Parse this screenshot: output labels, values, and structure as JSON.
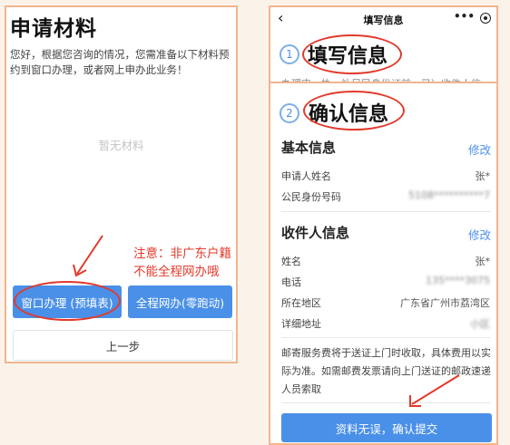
{
  "left": {
    "title": "申请材料",
    "description": "您好，根据您咨询的情况，您需准备以下材料预约到窗口办理，或者网上申办此业务！",
    "empty_text": "暂无材料",
    "note_line1": "注意：非广东户籍",
    "note_line2": "不能全程网办哦",
    "btn_window": "窗口办理 (预填表)",
    "btn_online": "全程网办(零跑动)",
    "btn_prev": "上一步"
  },
  "right": {
    "nav": {
      "back_icon": "‹",
      "title": "填写信息",
      "more_icon": "•••"
    },
    "step1": {
      "num": "1",
      "title": "填写信息",
      "subtitle": "办理申一执，补足民身份证前，已）收件人信"
    },
    "step2": {
      "num": "2",
      "title": "确认信息"
    },
    "basic": {
      "title": "基本信息",
      "edit": "修改",
      "rows": [
        {
          "label": "申请人姓名",
          "value": "张*"
        },
        {
          "label": "公民身份号码",
          "value": "5108**********7"
        }
      ]
    },
    "recipient": {
      "title": "收件人信息",
      "edit": "修改",
      "rows": [
        {
          "label": "姓名",
          "value": "张*"
        },
        {
          "label": "电话",
          "value": "135****3075"
        },
        {
          "label": "所在地区",
          "value": "广东省广州市荔湾区"
        },
        {
          "label": "详细地址",
          "value": "小区"
        }
      ]
    },
    "notice": "邮寄服务费将于送证上门时收取，具体费用以实际为准。如需邮费发票请向上门送证的邮政速递人员索取",
    "submit": "资料无误，确认提交"
  },
  "colors": {
    "accent": "#4a90e8",
    "annotation": "#e23a2b",
    "frame": "#f2b58e"
  }
}
